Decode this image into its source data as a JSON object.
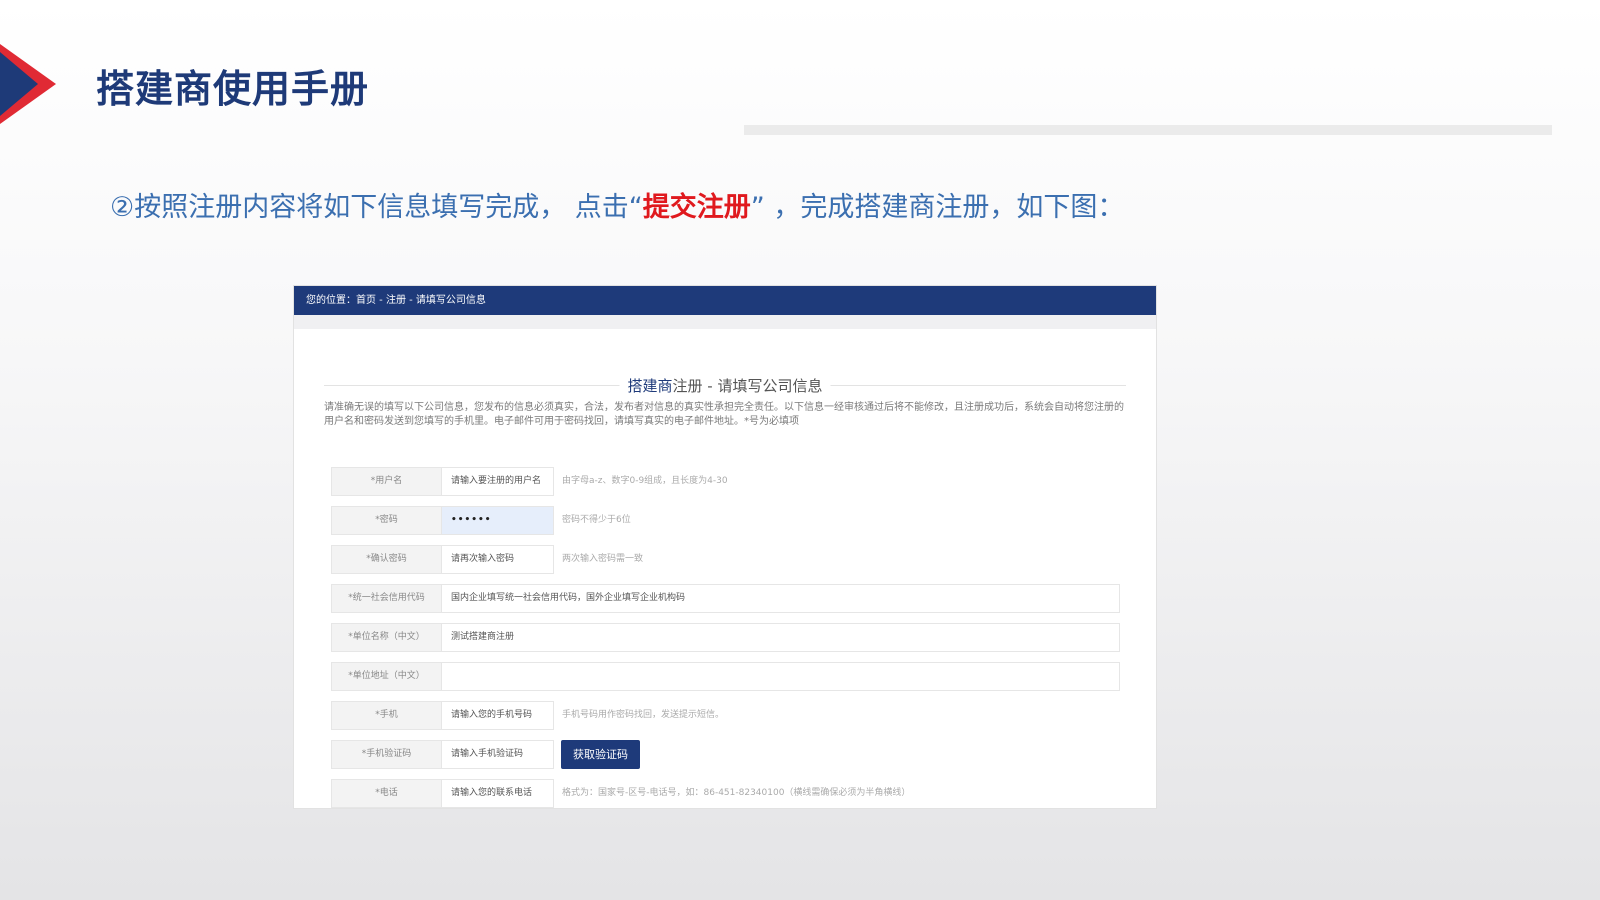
{
  "slide": {
    "title": "搭建商使用手册",
    "instruction_before": "②按照注册内容将如下信息填写完成， 点击“",
    "instruction_highlight": "提交注册",
    "instruction_after": "” ，完成搭建商注册，如下图："
  },
  "screenshot": {
    "breadcrumb": "您的位置：首页 - 注册 - 请填写公司信息",
    "heading_strong": "搭建商",
    "heading_rest": "注册 - 请填写公司信息",
    "notice": "请准确无误的填写以下公司信息，您发布的信息必须真实，合法，发布者对信息的真实性承担完全责任。以下信息一经审核通过后将不能修改，且注册成功后，系统会自动将您注册的用户名和密码发送到您填写的手机里。电子邮件可用于密码找回，请填写真实的电子邮件地址。*号为必填项",
    "fields": [
      {
        "label": "*用户名",
        "value": "请输入要注册的用户名",
        "hint": "由字母a-z、数字0-9组成，且长度为4-30"
      },
      {
        "label": "*密码",
        "value": "••••••",
        "hint": "密码不得少于6位"
      },
      {
        "label": "*确认密码",
        "value": "请再次输入密码",
        "hint": "两次输入密码需一致"
      },
      {
        "label": "*统一社会信用代码",
        "value": "国内企业填写统一社会信用代码，国外企业填写企业机构码",
        "hint": ""
      },
      {
        "label": "*单位名称（中文）",
        "value": "测试搭建商注册",
        "hint": ""
      },
      {
        "label": "*单位地址（中文）",
        "value": "",
        "hint": ""
      },
      {
        "label": "*手机",
        "value": "请输入您的手机号码",
        "hint": "手机号码用作密码找回，发送提示短信。"
      },
      {
        "label": "*手机验证码",
        "value": "请输入手机验证码",
        "hint": ""
      },
      {
        "label": "*电话",
        "value": "请输入您的联系电话",
        "hint": "格式为：国家号-区号-电话号，如：86-451-82340100（横线需确保必须为半角横线）"
      }
    ],
    "get_code_button": "获取验证码"
  },
  "colors": {
    "title_blue": "#1e3a78",
    "instruction_blue": "#3b6fb0",
    "highlight_red": "#e0191e",
    "nav_blue": "#1e3a7a"
  }
}
